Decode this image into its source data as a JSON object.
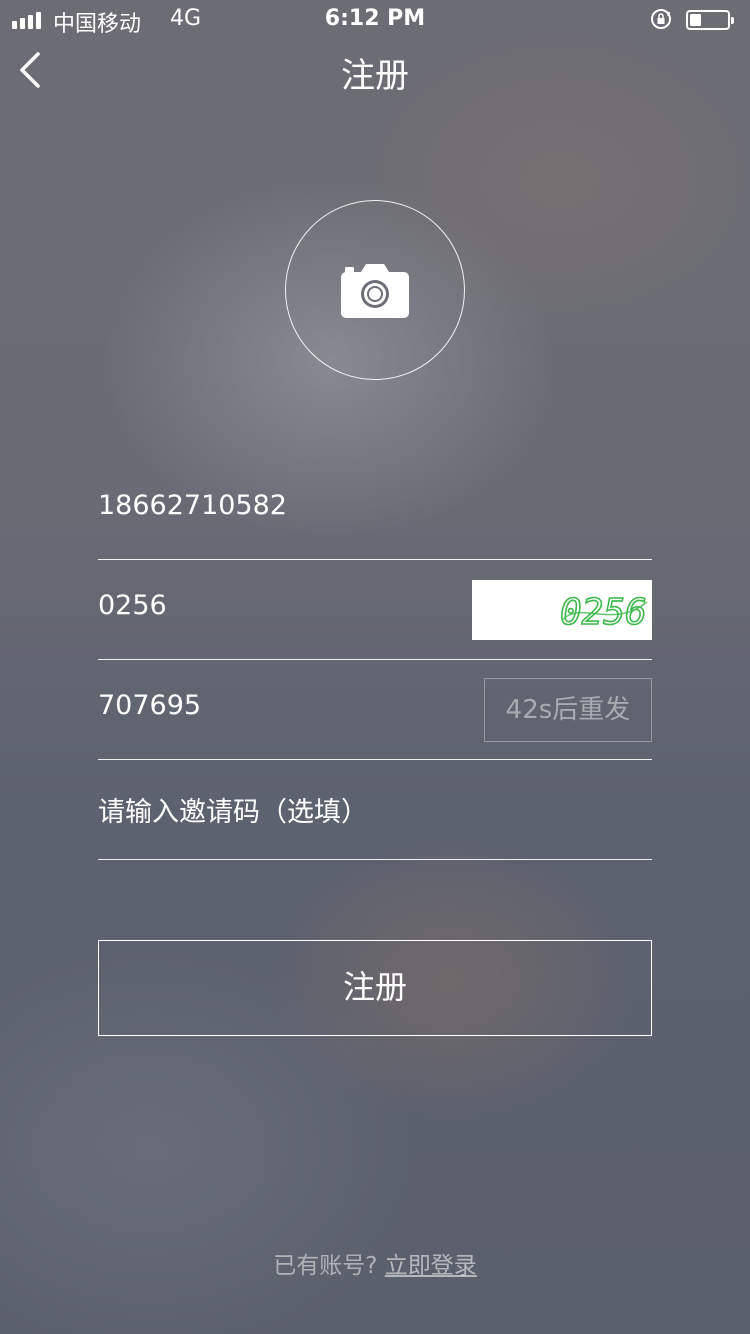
{
  "status_bar": {
    "carrier": "中国移动",
    "network": "4G",
    "time": "6:12 PM",
    "battery_level": 0.3
  },
  "nav": {
    "back_icon": "chevron-left-icon",
    "title": "注册"
  },
  "avatar": {
    "icon": "camera-icon"
  },
  "form": {
    "phone_value": "18662710582",
    "captcha_value": "0256",
    "captcha_image_text": "0256",
    "sms_code_value": "707695",
    "resend_label": "42s后重发",
    "invite_placeholder": "请输入邀请码（选填）"
  },
  "register_button": {
    "label": "注册"
  },
  "footer": {
    "prompt": "已有账号?",
    "login_link": "立即登录"
  },
  "colors": {
    "text": "#ffffff",
    "captcha_text": "#3cb84a",
    "muted": "#a9abb2"
  }
}
